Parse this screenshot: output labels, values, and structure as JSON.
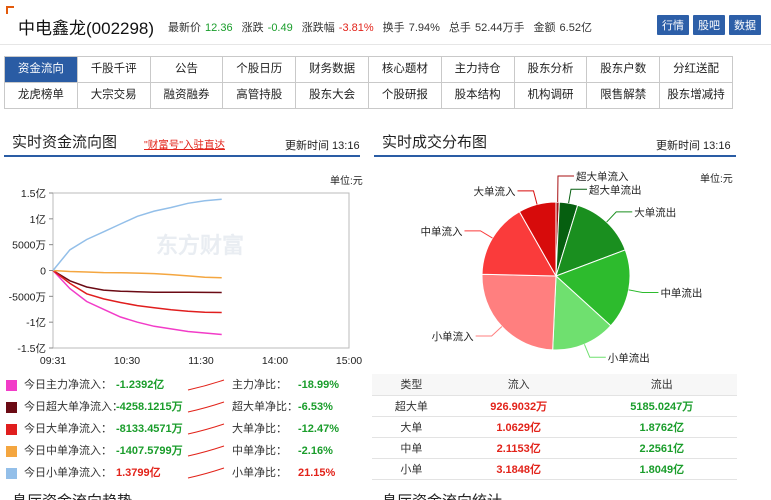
{
  "header": {
    "stock_name": "中电鑫龙(002298)",
    "quote": [
      {
        "label": "最新价",
        "value": "12.36",
        "tone": "grn"
      },
      {
        "label": "涨跌",
        "value": "-0.49",
        "tone": "grn"
      },
      {
        "label": "涨跌幅",
        "value": "-3.81%",
        "tone": "red"
      },
      {
        "label": "换手",
        "value": "7.94%",
        "tone": "lbl"
      },
      {
        "label": "总手",
        "value": "52.44万手",
        "tone": "lbl"
      },
      {
        "label": "金额",
        "value": "6.52亿",
        "tone": "lbl"
      }
    ],
    "buttons": [
      "行情",
      "股吧",
      "数据"
    ]
  },
  "nav": {
    "rows": [
      [
        "资金流向",
        "千股千评",
        "公告",
        "个股日历",
        "财务数据",
        "核心题材",
        "主力持仓",
        "股东分析",
        "股东户数",
        "分红送配"
      ],
      [
        "龙虎榜单",
        "大宗交易",
        "融资融券",
        "高管持股",
        "股东大会",
        "个股研报",
        "股本结构",
        "机构调研",
        "限售解禁",
        "股东增减持"
      ]
    ],
    "active": "资金流向"
  },
  "left_panel": {
    "title": "实时资金流向图",
    "link": "\"财富号\"入驻直达",
    "update": "更新时间 13:16",
    "unit": "单位:元",
    "watermark": "东方财富"
  },
  "right_panel": {
    "title": "实时成交分布图",
    "update": "更新时间 13:16",
    "unit": "单位:元"
  },
  "chart_data": [
    {
      "type": "line",
      "x_ticks": [
        "09:31",
        "10:30",
        "11:30",
        "14:00",
        "15:00"
      ],
      "y_ticks": [
        "1.5亿",
        "1亿",
        "5000万",
        "0",
        "-5000万",
        "-1亿",
        "-1.5亿"
      ],
      "ylim": [
        -150000000,
        150000000
      ],
      "series": [
        {
          "name": "今日主力净流入",
          "color": "#f23cc8",
          "values": [
            0,
            -35000000,
            -60000000,
            -75000000,
            -90000000,
            -100000000,
            -108000000,
            -113000000,
            -118000000,
            -121000000,
            -123920000
          ]
        },
        {
          "name": "今日超大单净流入",
          "color": "#6b0a14",
          "values": [
            0,
            -20000000,
            -32000000,
            -38000000,
            -40000000,
            -41000000,
            -42000000,
            -42000000,
            -42000000,
            -42300000,
            -42581215
          ]
        },
        {
          "name": "今日大单净流入",
          "color": "#e01e1e",
          "values": [
            0,
            -25000000,
            -45000000,
            -55000000,
            -62000000,
            -68000000,
            -72000000,
            -76000000,
            -79000000,
            -81000000,
            -81334571
          ]
        },
        {
          "name": "今日中单净流入",
          "color": "#f4a640",
          "values": [
            0,
            -2000000,
            -3000000,
            -4000000,
            -4500000,
            -5000000,
            -6000000,
            -8000000,
            -10500000,
            -13000000,
            -14075799
          ]
        },
        {
          "name": "今日小单净流入",
          "color": "#93bfe9",
          "values": [
            0,
            40000000,
            60000000,
            75000000,
            90000000,
            105000000,
            115000000,
            122000000,
            130000000,
            135000000,
            137990000
          ]
        }
      ]
    },
    {
      "type": "pie",
      "slices": [
        {
          "name": "超大单流入",
          "value": 926.9032,
          "color": "#a70f12"
        },
        {
          "name": "超大单流出",
          "value": 5185.0247,
          "color": "#065f10"
        },
        {
          "name": "大单流出",
          "value": 18762,
          "color": "#1a8f1f"
        },
        {
          "name": "中单流出",
          "value": 22561,
          "color": "#2dbb2d"
        },
        {
          "name": "小单流出",
          "value": 18049,
          "color": "#6fe06f"
        },
        {
          "name": "小单流入",
          "value": 31848,
          "color": "#ff7f7f"
        },
        {
          "name": "中单流入",
          "value": 21153,
          "color": "#fa3b3b"
        },
        {
          "name": "大单流入",
          "value": 10629,
          "color": "#d70b0b"
        }
      ]
    }
  ],
  "legend": [
    {
      "label": "今日主力净流入：",
      "value": "-1.2392亿",
      "tone": "grn",
      "color": "#f23cc8",
      "label2": "主力净比：",
      "pct": "-18.99%",
      "pct_tone": "grn"
    },
    {
      "label": "今日超大单净流入：",
      "value": "-4258.1215万",
      "tone": "grn",
      "color": "#6b0a14",
      "label2": "超大单净比：",
      "pct": "-6.53%",
      "pct_tone": "grn"
    },
    {
      "label": "今日大单净流入：",
      "value": "-8133.4571万",
      "tone": "grn",
      "color": "#e01e1e",
      "label2": "大单净比：",
      "pct": "-12.47%",
      "pct_tone": "grn"
    },
    {
      "label": "今日中单净流入：",
      "value": "-1407.5799万",
      "tone": "grn",
      "color": "#f4a640",
      "label2": "中单净比：",
      "pct": "-2.16%",
      "pct_tone": "grn"
    },
    {
      "label": "今日小单净流入：",
      "value": "1.3799亿",
      "tone": "red",
      "color": "#93bfe9",
      "label2": "小单净比：",
      "pct": "21.15%",
      "pct_tone": "red"
    }
  ],
  "table": {
    "headers": [
      "类型",
      "流入",
      "流出"
    ],
    "rows": [
      [
        "超大单",
        "926.9032万",
        "5185.0247万"
      ],
      [
        "大单",
        "1.0629亿",
        "1.8762亿"
      ],
      [
        "中单",
        "2.1153亿",
        "2.2561亿"
      ],
      [
        "小单",
        "3.1848亿",
        "1.8049亿"
      ]
    ]
  },
  "bottom": {
    "left": "息厅资金流向趋势",
    "right": "息厅资金流向统计"
  }
}
